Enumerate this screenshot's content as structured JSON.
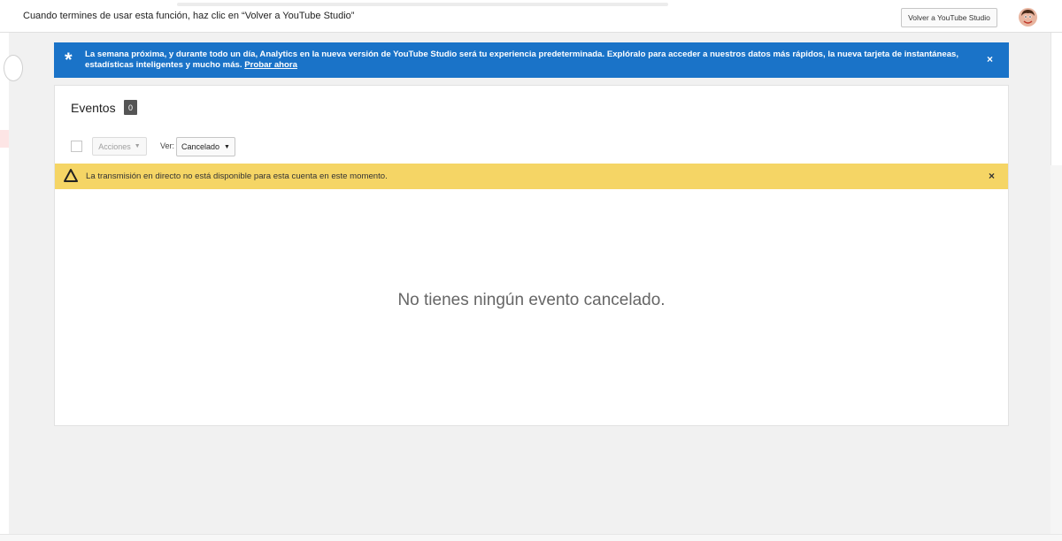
{
  "top_banner": {
    "message": "Cuando termines de usar esta función, haz clic en “Volver a YouTube Studio”",
    "back_button_label": "Volver a YouTube Studio"
  },
  "info_banner": {
    "text": "La semana próxima, y durante todo un día, Analytics en la nueva versión de YouTube Studio será tu experiencia predeterminada. Explóralo para acceder a nuestros datos más rápidos, la nueva tarjeta de instantáneas, estadísticas inteligentes y mucho más.",
    "link_label": "Probar ahora",
    "close_label": "×",
    "icon": "star-icon",
    "color": "#1a73c8"
  },
  "events": {
    "title": "Eventos",
    "count": "0",
    "actions_label": "Acciones",
    "view_label": "Ver:",
    "view_value": "Cancelado",
    "warning": {
      "text": "La transmisión en directo no está disponible para esta cuenta en este momento.",
      "close_label": "×",
      "icon": "warning-icon",
      "color": "#f5d565"
    },
    "empty_message": "No tienes ningún evento cancelado."
  }
}
